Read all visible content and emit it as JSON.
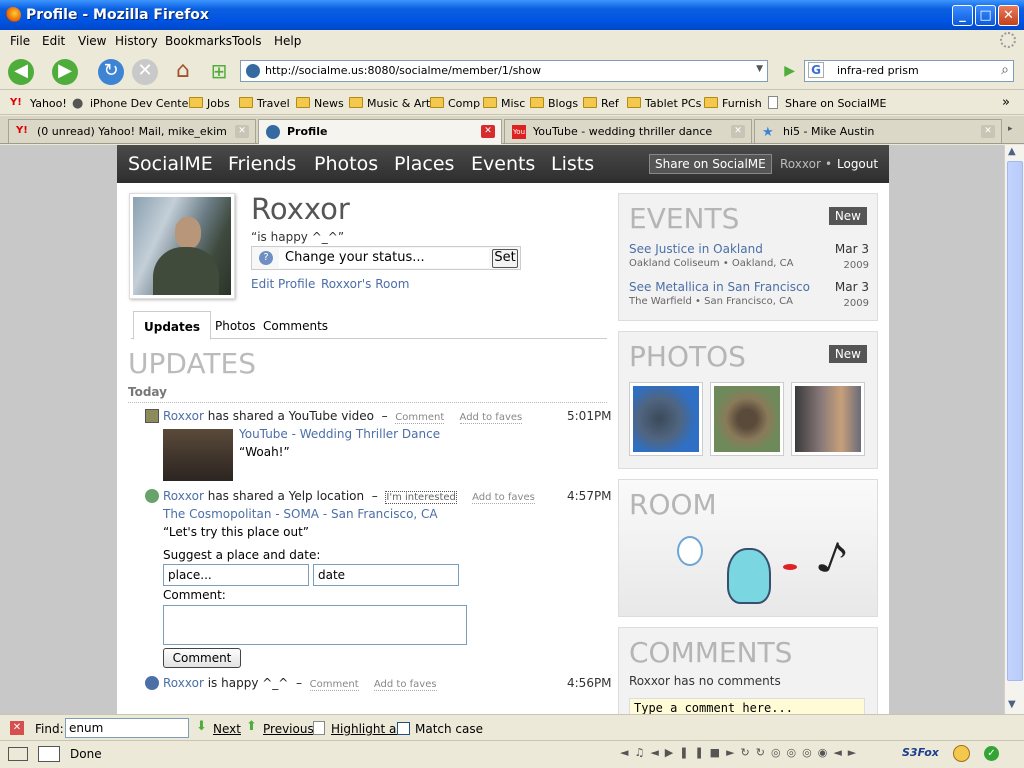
{
  "window": {
    "title": "Profile - Mozilla Firefox"
  },
  "menu": [
    "File",
    "Edit",
    "View",
    "History",
    "Bookmarks",
    "Tools",
    "Help"
  ],
  "nav": {
    "url": "http://socialme.us:8080/socialme/member/1/show",
    "search": "infra-red prism"
  },
  "bookmarks": [
    "Yahoo!",
    "iPhone Dev Center",
    "Jobs",
    "Travel",
    "News",
    "Music & Art",
    "Comp",
    "Misc",
    "Blogs",
    "Ref",
    "Tablet PCs",
    "Furnish",
    "Share on SocialME"
  ],
  "tabs": [
    "(0 unread) Yahoo! Mail, mike_ekim",
    "Profile",
    "YouTube - wedding thriller dance",
    "hi5 - Mike Austin"
  ],
  "site": {
    "brand": "SocialME",
    "nav": [
      "Friends",
      "Photos",
      "Places",
      "Events",
      "Lists"
    ],
    "share": "Share on SocialME",
    "user": "Roxxor",
    "sep": "•",
    "logout": "Logout"
  },
  "profile": {
    "name": "Roxxor",
    "status": "“is happy ^_^”",
    "status_placeholder": "Change your status...",
    "set": "Set",
    "edit": "Edit Profile",
    "room": "Roxxor's Room"
  },
  "subtabs": [
    "Updates",
    "Photos",
    "Comments"
  ],
  "updates": {
    "heading": "UPDATES",
    "today": "Today",
    "item1": {
      "user": "Roxxor",
      "text": "has shared a YouTube video",
      "dash": "–",
      "comment": "Comment",
      "faves": "Add to faves",
      "time": "5:01PM",
      "title": "YouTube - Wedding Thriller Dance",
      "quote": "“Woah!”"
    },
    "item2": {
      "user": "Roxxor",
      "text": "has shared a Yelp location",
      "dash": "–",
      "interested": "I'm interested",
      "faves": "Add to faves",
      "time": "4:57PM",
      "title": "The Cosmopolitan - SOMA - San Francisco, CA",
      "quote": "“Let's try this place out”",
      "suggest": "Suggest a place and date:",
      "place": "place...",
      "date": "date",
      "comment_label": "Comment:",
      "comment_btn": "Comment"
    },
    "item3": {
      "user": "Roxxor",
      "text": "is happy ^_^",
      "dash": "–",
      "comment": "Comment",
      "faves": "Add to faves",
      "time": "4:56PM"
    }
  },
  "events": {
    "heading": "EVENTS",
    "new": "New",
    "items": [
      {
        "title": "See Justice in Oakland",
        "date": "Mar 3",
        "venue": "Oakland Coliseum • Oakland, CA",
        "year": "2009"
      },
      {
        "title": "See Metallica in San Francisco",
        "date": "Mar 3",
        "venue": "The Warfield • San Francisco, CA",
        "year": "2009"
      }
    ]
  },
  "photos": {
    "heading": "PHOTOS",
    "new": "New"
  },
  "room": {
    "heading": "ROOM"
  },
  "comments": {
    "heading": "COMMENTS",
    "empty": "Roxxor has no comments",
    "placeholder": "Type a comment here..."
  },
  "find": {
    "label": "Find:",
    "value": "enum",
    "next": "Next",
    "prev": "Previous",
    "highlight": "Highlight all",
    "match": "Match case"
  },
  "status": {
    "text": "Done",
    "s3fox": "S3Fox"
  }
}
